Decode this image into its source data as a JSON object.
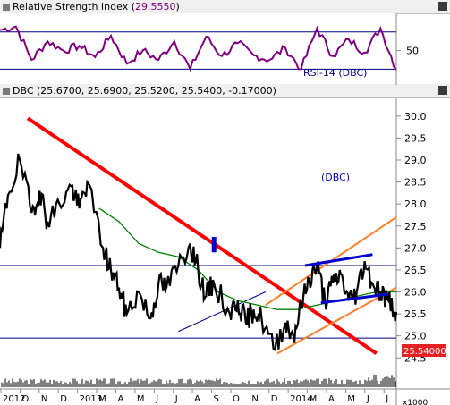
{
  "rsi_panel": {
    "title_prefix": "Relative Strength Index (",
    "value": "29.5550",
    "title_suffix": ")",
    "series_label": "RSI-14 (DBC)",
    "scale_label": "50",
    "color": "#800080",
    "level_color": "#00008b"
  },
  "price_panel": {
    "title": "DBC (25.6700, 25.6900, 25.5200, 25.5400, -0.17000)",
    "chart_label": "(DBC)",
    "last_price_tag": "25.54000",
    "volume_multiplier": "x1000",
    "price_color": "#000000",
    "ma_color": "#008000",
    "trend_red": "#ff0000",
    "trend_orange": "#ff7f27",
    "trend_blue": "#0000cc",
    "tag_color": "#e82020"
  },
  "chart_data": [
    {
      "type": "line",
      "title": "Relative Strength Index",
      "ylabel": "",
      "yticks": [
        50
      ],
      "levels": [
        30,
        70
      ],
      "ylim": [
        15,
        90
      ],
      "series": [
        {
          "name": "RSI-14 (DBC)",
          "x": [
            0,
            4,
            8,
            12,
            16,
            20,
            24,
            28,
            32,
            36,
            40,
            44,
            48,
            52,
            56,
            60,
            64,
            68,
            72,
            76,
            80,
            84,
            88,
            92,
            96,
            100
          ],
          "values": [
            72,
            76,
            40,
            60,
            50,
            55,
            43,
            66,
            36,
            50,
            40,
            60,
            30,
            65,
            44,
            58,
            45,
            40,
            53,
            30,
            74,
            44,
            62,
            48,
            74,
            29.6
          ]
        }
      ]
    },
    {
      "type": "line",
      "title": "DBC",
      "ylim": [
        24.2,
        30.2
      ],
      "yticks": [
        "24.5",
        "25.0",
        "25.5",
        "26.0",
        "26.5",
        "27.0",
        "27.5",
        "28.0",
        "28.5",
        "29.0",
        "29.5",
        "30.0"
      ],
      "xlabels": [
        "2012",
        "O",
        "N",
        "D",
        "2013",
        "M",
        "A",
        "M",
        "J",
        "J",
        "A",
        "S",
        "O",
        "N",
        "D",
        "2014",
        "M",
        "A",
        "M",
        "J",
        "J"
      ],
      "horizontal_levels": [
        27.75,
        26.6,
        24.95
      ],
      "series": [
        {
          "name": "DBC",
          "x": [
            0,
            2,
            5,
            8,
            10,
            12,
            15,
            18,
            20,
            22,
            26,
            28,
            30,
            32,
            35,
            38,
            40,
            42,
            45,
            48,
            50,
            52,
            54,
            58,
            60,
            62,
            64,
            66,
            69,
            72,
            74,
            76,
            78,
            80,
            82,
            84,
            86,
            88,
            90,
            92,
            94,
            96,
            98,
            100
          ],
          "values": [
            27.0,
            28.2,
            29.0,
            27.8,
            28.3,
            27.6,
            28.0,
            28.4,
            27.9,
            28.5,
            27.0,
            26.5,
            26.1,
            25.5,
            26.0,
            25.4,
            26.2,
            26.1,
            26.6,
            27.1,
            26.5,
            25.9,
            26.2,
            25.5,
            25.8,
            25.3,
            25.6,
            25.4,
            24.7,
            25.3,
            25.0,
            25.7,
            26.3,
            26.6,
            25.8,
            26.2,
            26.4,
            25.8,
            26.0,
            26.7,
            26.2,
            26.0,
            25.8,
            25.54
          ]
        },
        {
          "name": "Moving average",
          "x": [
            25,
            30,
            35,
            40,
            45,
            50,
            55,
            60,
            65,
            70,
            75,
            80,
            85,
            90,
            95,
            100
          ],
          "values": [
            27.9,
            27.6,
            27.1,
            26.9,
            26.8,
            26.5,
            26.0,
            25.8,
            25.7,
            25.6,
            25.6,
            25.7,
            25.8,
            25.9,
            26.0,
            26.0
          ]
        }
      ]
    }
  ]
}
